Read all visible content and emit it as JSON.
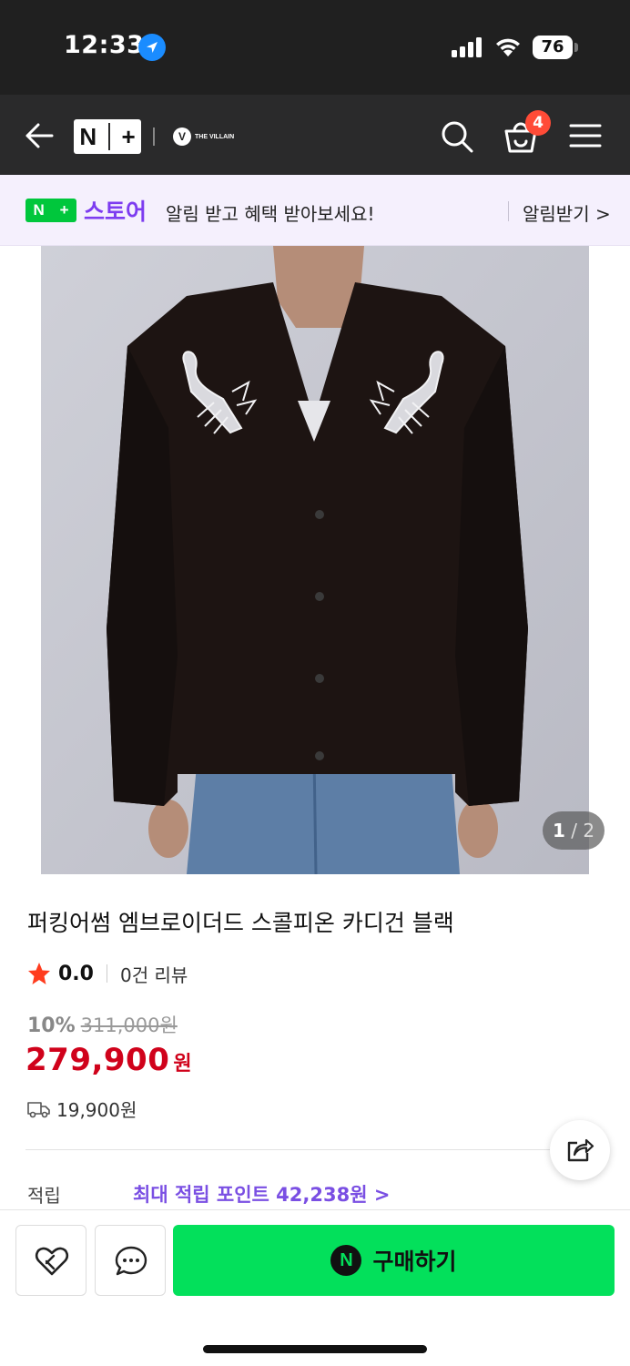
{
  "status_bar": {
    "time": "12:33",
    "battery": "76"
  },
  "nav": {
    "logo_text_n": "N",
    "logo_text_plus": "+",
    "brand_logo_letter": "V",
    "brand_logo_text": "THE VILLAIN",
    "cart_count": "4"
  },
  "store_banner": {
    "logo_n": "N",
    "logo_plus": "+",
    "store_name": "스토어",
    "message": "알림 받고 혜택 받아보세요!",
    "alarm_link": "알림받기 >"
  },
  "product": {
    "image_counter_current": "1",
    "image_counter_total": "/ 2",
    "title": "퍼킹어썸 엠브로이더드 스콜피온 카디건 블랙",
    "rating": "0.0",
    "reviews": "0건 리뷰",
    "discount_rate": "10%",
    "original_price": "311,000원",
    "price": "279,900",
    "price_unit": "원",
    "shipping_fee": "19,900원",
    "points_label": "적립",
    "points_link": "최대 적립 포인트 42,238원 >"
  },
  "bottom_bar": {
    "npay_letter": "N",
    "buy_label": "구매하기"
  },
  "colors": {
    "accent_green": "#03e05b",
    "price_red": "#d0021b",
    "store_purple": "#7d3cf0",
    "badge_red": "#ff4b37"
  }
}
